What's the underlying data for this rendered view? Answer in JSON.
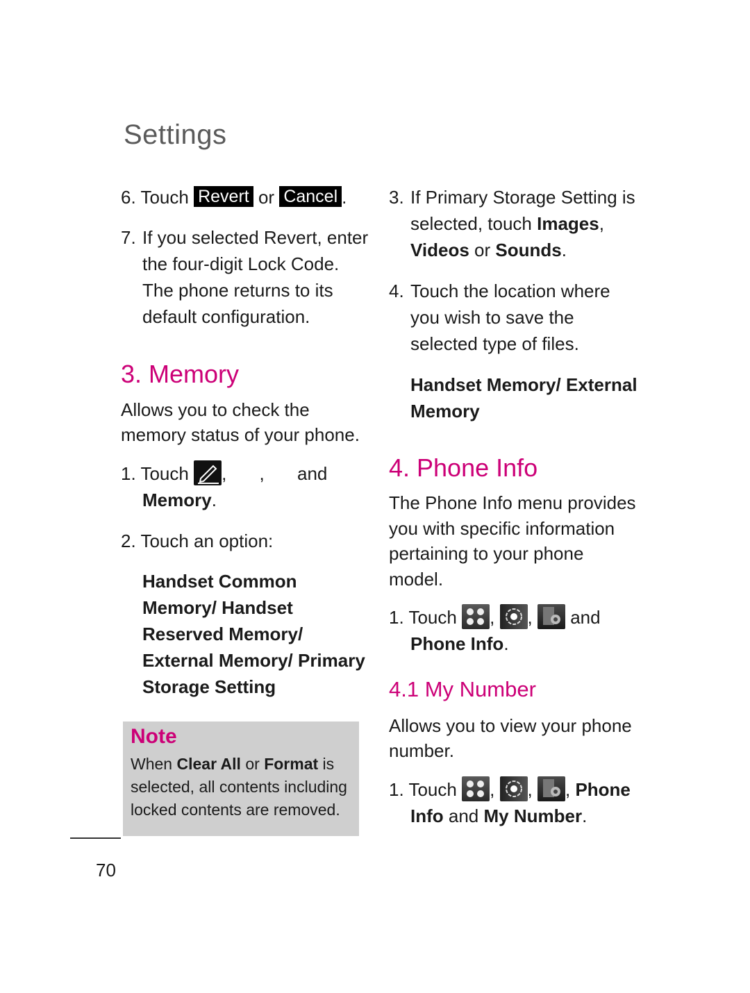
{
  "header": {
    "title": "Settings"
  },
  "left": {
    "step6": {
      "num": "6.",
      "pre": "Touch",
      "btn1": "Revert",
      "mid": "or",
      "btn2": "Cancel",
      "end": "."
    },
    "step7": {
      "num": "7.",
      "lines": [
        "If you selected Revert, enter",
        "the four-digit Lock Code.",
        "The phone returns to its",
        "default configuration."
      ]
    },
    "memory": {
      "heading": "3. Memory",
      "desc": [
        "Allows you to check the",
        "memory status of your phone."
      ],
      "step1": {
        "num": "1.",
        "pre": "Touch",
        "sep1": ",",
        "sep2": ",",
        "and": "and",
        "target": "Memory",
        "end": "."
      },
      "step2": {
        "num": "2.",
        "text": "Touch an option:"
      },
      "options": [
        "Handset Common",
        "Memory/ Handset",
        "Reserved Memory/",
        "External Memory/ Primary",
        "Storage Setting"
      ]
    },
    "note": {
      "title": "Note",
      "l1_pre": "When",
      "l1_b1": "Clear All",
      "l1_mid": "or",
      "l1_b2": "Format",
      "l1_end": "is",
      "l2": "selected, all contents including",
      "l3": "locked contents are removed."
    }
  },
  "right": {
    "step3": {
      "num": "3.",
      "l1": "If Primary Storage Setting is",
      "l2_pre": "selected, touch",
      "l2_b": "Images",
      "l2_end": ",",
      "l3_b1": "Videos",
      "l3_mid": "or",
      "l3_b2": "Sounds",
      "l3_end": "."
    },
    "step4": {
      "num": "4.",
      "lines": [
        "Touch the location where",
        "you wish to save the",
        "selected type of files."
      ]
    },
    "locations": [
      "Handset Memory/ External",
      "Memory"
    ],
    "phone_info": {
      "heading": "4. Phone Info",
      "desc": [
        "The Phone Info menu provides",
        "you with specific information",
        "pertaining to your phone",
        "model."
      ],
      "step1": {
        "num": "1.",
        "pre": "Touch",
        "and": "and",
        "target": "Phone Info",
        "end": "."
      }
    },
    "my_number": {
      "heading": "4.1 My Number",
      "desc": [
        "Allows you to view your phone",
        "number."
      ],
      "step1": {
        "num": "1.",
        "pre": "Touch",
        "b1": "Phone",
        "b2": "Info",
        "and": "and",
        "b3": "My Number",
        "end": "."
      }
    }
  },
  "footer": {
    "page_number": "70"
  },
  "icons": [
    "edit-icon",
    "menu-grid-icon",
    "settings-gear-icon",
    "phone-settings-icon"
  ]
}
